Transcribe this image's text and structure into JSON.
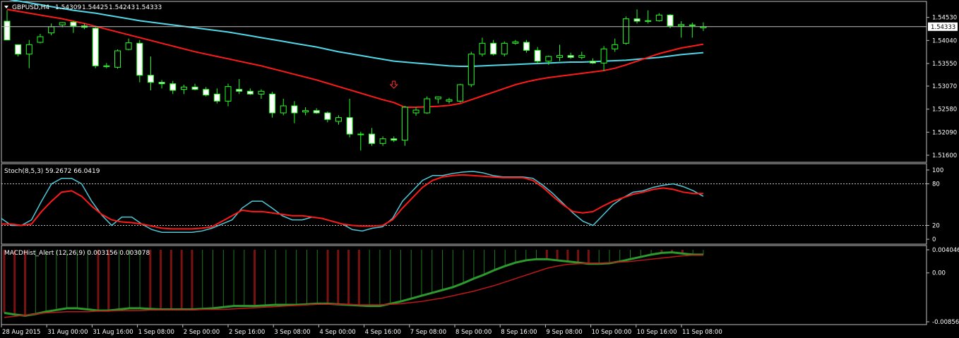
{
  "chart_data": [
    {
      "type": "candlestick",
      "title": "GBPUSD,H4",
      "ohlc_header": [
        "1.54309",
        "1.54425",
        "1.54243",
        "1.54333"
      ],
      "y_ticks": [
        1.5453,
        1.5404,
        1.5355,
        1.5307,
        1.5258,
        1.5209,
        1.516
      ],
      "y_tick_labels": [
        "1.54530",
        "1.54040",
        "1.53550",
        "1.53070",
        "1.52580",
        "1.52090",
        "1.51600"
      ],
      "ylim": [
        1.5148,
        1.5484
      ],
      "current_price": 1.54333,
      "current_price_label": "1.54333",
      "bullish_color": "#22ff22",
      "bearish_color": "#ffffff",
      "signal_arrow": {
        "index": 35,
        "price": 1.531,
        "color": "#ff3030",
        "icon": "down-arrow-icon"
      },
      "candles": [
        {
          "o": 1.5445,
          "h": 1.5468,
          "l": 1.5405,
          "c": 1.5405
        },
        {
          "o": 1.5395,
          "h": 1.5395,
          "l": 1.537,
          "c": 1.5375
        },
        {
          "o": 1.5375,
          "h": 1.5405,
          "l": 1.5345,
          "c": 1.5395
        },
        {
          "o": 1.54,
          "h": 1.5418,
          "l": 1.5398,
          "c": 1.5412
        },
        {
          "o": 1.542,
          "h": 1.544,
          "l": 1.5415,
          "c": 1.5433
        },
        {
          "o": 1.5437,
          "h": 1.5443,
          "l": 1.5432,
          "c": 1.5442
        },
        {
          "o": 1.5443,
          "h": 1.5445,
          "l": 1.542,
          "c": 1.5435
        },
        {
          "o": 1.5435,
          "h": 1.544,
          "l": 1.5428,
          "c": 1.5432
        },
        {
          "o": 1.543,
          "h": 1.5432,
          "l": 1.5345,
          "c": 1.535
        },
        {
          "o": 1.535,
          "h": 1.5356,
          "l": 1.5345,
          "c": 1.5349
        },
        {
          "o": 1.5347,
          "h": 1.5385,
          "l": 1.5344,
          "c": 1.5382
        },
        {
          "o": 1.5385,
          "h": 1.5408,
          "l": 1.5383,
          "c": 1.5399
        },
        {
          "o": 1.5398,
          "h": 1.5405,
          "l": 1.5315,
          "c": 1.533
        },
        {
          "o": 1.533,
          "h": 1.537,
          "l": 1.5298,
          "c": 1.5315
        },
        {
          "o": 1.5315,
          "h": 1.532,
          "l": 1.5302,
          "c": 1.5312
        },
        {
          "o": 1.5312,
          "h": 1.5318,
          "l": 1.529,
          "c": 1.5298
        },
        {
          "o": 1.53,
          "h": 1.531,
          "l": 1.529,
          "c": 1.5305
        },
        {
          "o": 1.5305,
          "h": 1.5312,
          "l": 1.5298,
          "c": 1.53
        },
        {
          "o": 1.53,
          "h": 1.5305,
          "l": 1.5285,
          "c": 1.5288
        },
        {
          "o": 1.529,
          "h": 1.5302,
          "l": 1.527,
          "c": 1.5275
        },
        {
          "o": 1.5275,
          "h": 1.5312,
          "l": 1.5264,
          "c": 1.5306
        },
        {
          "o": 1.53,
          "h": 1.5322,
          "l": 1.529,
          "c": 1.5296
        },
        {
          "o": 1.5296,
          "h": 1.5302,
          "l": 1.5288,
          "c": 1.529
        },
        {
          "o": 1.529,
          "h": 1.53,
          "l": 1.528,
          "c": 1.5296
        },
        {
          "o": 1.529,
          "h": 1.5295,
          "l": 1.524,
          "c": 1.525
        },
        {
          "o": 1.525,
          "h": 1.528,
          "l": 1.5245,
          "c": 1.5265
        },
        {
          "o": 1.5265,
          "h": 1.5275,
          "l": 1.5228,
          "c": 1.525
        },
        {
          "o": 1.5252,
          "h": 1.5262,
          "l": 1.5245,
          "c": 1.5255
        },
        {
          "o": 1.5255,
          "h": 1.526,
          "l": 1.5248,
          "c": 1.525
        },
        {
          "o": 1.525,
          "h": 1.5253,
          "l": 1.523,
          "c": 1.5236
        },
        {
          "o": 1.5232,
          "h": 1.5245,
          "l": 1.5225,
          "c": 1.524
        },
        {
          "o": 1.524,
          "h": 1.528,
          "l": 1.5198,
          "c": 1.5205
        },
        {
          "o": 1.5205,
          "h": 1.521,
          "l": 1.517,
          "c": 1.5205
        },
        {
          "o": 1.5205,
          "h": 1.5218,
          "l": 1.518,
          "c": 1.5185
        },
        {
          "o": 1.5185,
          "h": 1.52,
          "l": 1.518,
          "c": 1.5195
        },
        {
          "o": 1.5195,
          "h": 1.52,
          "l": 1.5188,
          "c": 1.5192
        },
        {
          "o": 1.5192,
          "h": 1.5265,
          "l": 1.518,
          "c": 1.5262
        },
        {
          "o": 1.525,
          "h": 1.5262,
          "l": 1.5244,
          "c": 1.5256
        },
        {
          "o": 1.525,
          "h": 1.5285,
          "l": 1.5248,
          "c": 1.528
        },
        {
          "o": 1.528,
          "h": 1.5285,
          "l": 1.527,
          "c": 1.5284
        },
        {
          "o": 1.5275,
          "h": 1.5282,
          "l": 1.527,
          "c": 1.5278
        },
        {
          "o": 1.5275,
          "h": 1.5312,
          "l": 1.5272,
          "c": 1.531
        },
        {
          "o": 1.531,
          "h": 1.538,
          "l": 1.5305,
          "c": 1.5375
        },
        {
          "o": 1.5375,
          "h": 1.541,
          "l": 1.537,
          "c": 1.5398
        },
        {
          "o": 1.5398,
          "h": 1.5405,
          "l": 1.5372,
          "c": 1.5375
        },
        {
          "o": 1.5375,
          "h": 1.5402,
          "l": 1.537,
          "c": 1.5398
        },
        {
          "o": 1.5398,
          "h": 1.5405,
          "l": 1.5395,
          "c": 1.5401
        },
        {
          "o": 1.54,
          "h": 1.5405,
          "l": 1.5378,
          "c": 1.5383
        },
        {
          "o": 1.5383,
          "h": 1.539,
          "l": 1.5355,
          "c": 1.536
        },
        {
          "o": 1.536,
          "h": 1.5372,
          "l": 1.5352,
          "c": 1.537
        },
        {
          "o": 1.5368,
          "h": 1.5395,
          "l": 1.536,
          "c": 1.5372
        },
        {
          "o": 1.5372,
          "h": 1.5378,
          "l": 1.5365,
          "c": 1.5368
        },
        {
          "o": 1.5368,
          "h": 1.538,
          "l": 1.5364,
          "c": 1.5372
        },
        {
          "o": 1.536,
          "h": 1.5366,
          "l": 1.5354,
          "c": 1.5356
        },
        {
          "o": 1.5356,
          "h": 1.5392,
          "l": 1.534,
          "c": 1.5386
        },
        {
          "o": 1.5386,
          "h": 1.5408,
          "l": 1.538,
          "c": 1.5395
        },
        {
          "o": 1.5398,
          "h": 1.5455,
          "l": 1.5395,
          "c": 1.545
        },
        {
          "o": 1.545,
          "h": 1.547,
          "l": 1.544,
          "c": 1.5445
        },
        {
          "o": 1.5445,
          "h": 1.5468,
          "l": 1.544,
          "c": 1.5446
        },
        {
          "o": 1.5446,
          "h": 1.5462,
          "l": 1.5444,
          "c": 1.5458
        },
        {
          "o": 1.5458,
          "h": 1.546,
          "l": 1.543,
          "c": 1.5435
        },
        {
          "o": 1.5435,
          "h": 1.5445,
          "l": 1.541,
          "c": 1.5438
        },
        {
          "o": 1.5436,
          "h": 1.5442,
          "l": 1.541,
          "c": 1.5437
        },
        {
          "o": 1.54309,
          "h": 1.54425,
          "l": 1.54243,
          "c": 1.54333
        }
      ],
      "series": [
        {
          "color": "#4fd8e8",
          "values": [
            1.5492,
            1.5488,
            1.5484,
            1.548,
            1.5476,
            1.5472,
            1.5468,
            1.5465,
            1.5462,
            1.5458,
            1.5454,
            1.545,
            1.5446,
            1.5443,
            1.544,
            1.5437,
            1.5434,
            1.5431,
            1.5428,
            1.5425,
            1.5422,
            1.5418,
            1.5414,
            1.541,
            1.5406,
            1.5402,
            1.5398,
            1.5394,
            1.539,
            1.5385,
            1.538,
            1.5376,
            1.5372,
            1.5368,
            1.5364,
            1.536,
            1.5358,
            1.5356,
            1.5354,
            1.5352,
            1.535,
            1.5349,
            1.5349,
            1.535,
            1.5351,
            1.5352,
            1.5353,
            1.5354,
            1.5355,
            1.5356,
            1.5357,
            1.5358,
            1.5358,
            1.5359,
            1.536,
            1.5361,
            1.5362,
            1.5364,
            1.5366,
            1.5368,
            1.5371,
            1.5374,
            1.5376,
            1.5378
          ]
        },
        {
          "color": "#ff1a1a",
          "values": [
            1.547,
            1.5466,
            1.5462,
            1.5458,
            1.5454,
            1.545,
            1.5445,
            1.544,
            1.5434,
            1.5428,
            1.5422,
            1.5416,
            1.541,
            1.5404,
            1.5398,
            1.5392,
            1.5386,
            1.538,
            1.5375,
            1.537,
            1.5365,
            1.536,
            1.5355,
            1.535,
            1.5344,
            1.5338,
            1.5332,
            1.5326,
            1.532,
            1.5313,
            1.5306,
            1.5299,
            1.5292,
            1.5285,
            1.5278,
            1.5272,
            1.5262,
            1.5262,
            1.5263,
            1.5264,
            1.5266,
            1.527,
            1.5278,
            1.5286,
            1.5294,
            1.5302,
            1.531,
            1.5316,
            1.5321,
            1.5325,
            1.5328,
            1.5331,
            1.5334,
            1.5337,
            1.534,
            1.5345,
            1.5352,
            1.536,
            1.5368,
            1.5376,
            1.5382,
            1.5388,
            1.5392,
            1.5396
          ]
        }
      ]
    },
    {
      "type": "line",
      "title": "Stoch(8,5,3) 59.2672 66.0419",
      "y_tick_labels": [
        "100",
        "80",
        "20",
        "0"
      ],
      "ylim": [
        -5,
        105
      ],
      "levels": [
        80,
        20
      ],
      "series": [
        {
          "color": "#4fc8d8",
          "values": [
            30,
            20,
            20,
            28,
            55,
            80,
            88,
            88,
            80,
            55,
            35,
            20,
            32,
            32,
            22,
            14,
            10,
            10,
            10,
            10,
            12,
            16,
            22,
            28,
            45,
            55,
            55,
            45,
            34,
            28,
            28,
            32,
            30,
            26,
            22,
            14,
            12,
            16,
            18,
            30,
            55,
            70,
            85,
            92,
            92,
            95,
            97,
            98,
            96,
            92,
            90,
            90,
            90,
            88,
            78,
            66,
            52,
            38,
            26,
            20,
            35,
            50,
            60,
            68,
            70,
            75,
            78,
            80,
            76,
            70,
            62
          ]
        },
        {
          "color": "#ff1a1a",
          "values": [
            22,
            22,
            20,
            22,
            40,
            55,
            68,
            70,
            62,
            48,
            36,
            28,
            25,
            24,
            22,
            19,
            16,
            15,
            15,
            15,
            16,
            18,
            26,
            34,
            42,
            40,
            40,
            38,
            36,
            34,
            34,
            32,
            30,
            26,
            22,
            20,
            19,
            19,
            20,
            28,
            45,
            60,
            75,
            85,
            90,
            92,
            93,
            92,
            91,
            90,
            89,
            89,
            89,
            85,
            75,
            62,
            50,
            40,
            38,
            40,
            48,
            55,
            60,
            65,
            68,
            72,
            74,
            72,
            68,
            66,
            66
          ]
        }
      ]
    },
    {
      "type": "bar",
      "title": "MACDHist_Alert (12,26,9)  0.003156 0.003078",
      "y_tick_labels": [
        "0.004046",
        "0.00",
        "-0.008562"
      ],
      "ylim": [
        -0.008562,
        0.004046
      ],
      "colors": {
        "up": "#1f7a1f",
        "down": "#7a1212"
      },
      "histogram_colors": [
        "down",
        "down",
        "down",
        "up",
        "up",
        "up",
        "up",
        "up",
        "up",
        "down",
        "down",
        "up",
        "up",
        "up",
        "down",
        "down",
        "down",
        "down",
        "down",
        "up",
        "up",
        "up",
        "up",
        "up",
        "down",
        "up",
        "up",
        "up",
        "up",
        "up",
        "up",
        "down",
        "down",
        "down",
        "down",
        "up",
        "up",
        "up",
        "up",
        "up",
        "up",
        "up",
        "up",
        "up",
        "up",
        "up",
        "up",
        "up",
        "up",
        "up",
        "up",
        "up",
        "down",
        "down",
        "down",
        "down",
        "down",
        "up",
        "up",
        "up",
        "up",
        "up",
        "up",
        "down",
        "down",
        "down"
      ],
      "series": [
        {
          "color": "#2d9a2d",
          "values": [
            -0.007,
            -0.0073,
            -0.0075,
            -0.0072,
            -0.0068,
            -0.0065,
            -0.0062,
            -0.0062,
            -0.0064,
            -0.0066,
            -0.0066,
            -0.0064,
            -0.0062,
            -0.0062,
            -0.0063,
            -0.0064,
            -0.0064,
            -0.0064,
            -0.0064,
            -0.0063,
            -0.0062,
            -0.006,
            -0.0058,
            -0.0058,
            -0.0058,
            -0.0057,
            -0.0056,
            -0.0056,
            -0.0056,
            -0.0055,
            -0.0054,
            -0.0054,
            -0.0055,
            -0.0056,
            -0.0057,
            -0.0058,
            -0.0058,
            -0.0054,
            -0.005,
            -0.0045,
            -0.004,
            -0.0035,
            -0.003,
            -0.0025,
            -0.0018,
            -0.001,
            -0.0003,
            0.0005,
            0.0012,
            0.0018,
            0.0022,
            0.0024,
            0.0024,
            0.0022,
            0.002,
            0.0018,
            0.0016,
            0.0016,
            0.0017,
            0.002,
            0.0024,
            0.0028,
            0.0032,
            0.0035,
            0.0036,
            0.0034,
            0.0032,
            0.0032
          ]
        },
        {
          "color": "#c01818",
          "values": [
            -0.0078,
            -0.0076,
            -0.0074,
            -0.0072,
            -0.007,
            -0.0069,
            -0.0068,
            -0.0068,
            -0.0068,
            -0.0067,
            -0.0067,
            -0.0066,
            -0.0066,
            -0.0066,
            -0.0065,
            -0.0065,
            -0.0065,
            -0.0065,
            -0.0065,
            -0.0064,
            -0.0064,
            -0.0064,
            -0.0063,
            -0.0062,
            -0.0061,
            -0.006,
            -0.0059,
            -0.0058,
            -0.0057,
            -0.0056,
            -0.0055,
            -0.0055,
            -0.0055,
            -0.0055,
            -0.0056,
            -0.0056,
            -0.0056,
            -0.0055,
            -0.0054,
            -0.0052,
            -0.005,
            -0.0047,
            -0.0044,
            -0.004,
            -0.0036,
            -0.0032,
            -0.0027,
            -0.0022,
            -0.0016,
            -0.001,
            -0.0004,
            0.0002,
            0.0008,
            0.0012,
            0.0015,
            0.0016,
            0.0017,
            0.0017,
            0.0018,
            0.0019,
            0.002,
            0.0022,
            0.0024,
            0.0026,
            0.0028,
            0.003,
            0.0031,
            0.0031
          ]
        }
      ]
    }
  ],
  "x_axis_labels": [
    "28 Aug 2015",
    "31 Aug 00:00",
    "31 Aug 16:00",
    "1 Sep 08:00",
    "2 Sep 00:00",
    "2 Sep 16:00",
    "3 Sep 08:00",
    "4 Sep 00:00",
    "4 Sep 16:00",
    "7 Sep 08:00",
    "8 Sep 00:00",
    "8 Sep 16:00",
    "9 Sep 08:00",
    "10 Sep 00:00",
    "10 Sep 16:00",
    "11 Sep 08:00"
  ]
}
